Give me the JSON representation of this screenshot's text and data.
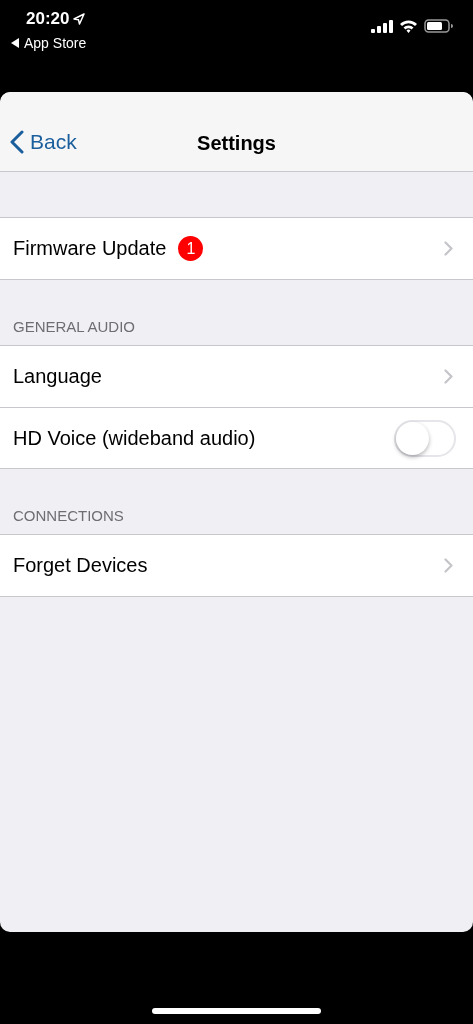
{
  "status_bar": {
    "time": "20:20",
    "back_app": "App Store"
  },
  "nav_bar": {
    "back_label": "Back",
    "title": "Settings"
  },
  "sections": [
    {
      "rows": [
        {
          "kind": "link",
          "label": "Firmware Update",
          "badge": "1"
        }
      ]
    },
    {
      "header": "GENERAL AUDIO",
      "rows": [
        {
          "kind": "link",
          "label": "Language"
        },
        {
          "kind": "toggle",
          "label": "HD Voice (wideband audio)",
          "on": false
        }
      ]
    },
    {
      "header": "CONNECTIONS",
      "rows": [
        {
          "kind": "link",
          "label": "Forget Devices"
        }
      ]
    }
  ]
}
